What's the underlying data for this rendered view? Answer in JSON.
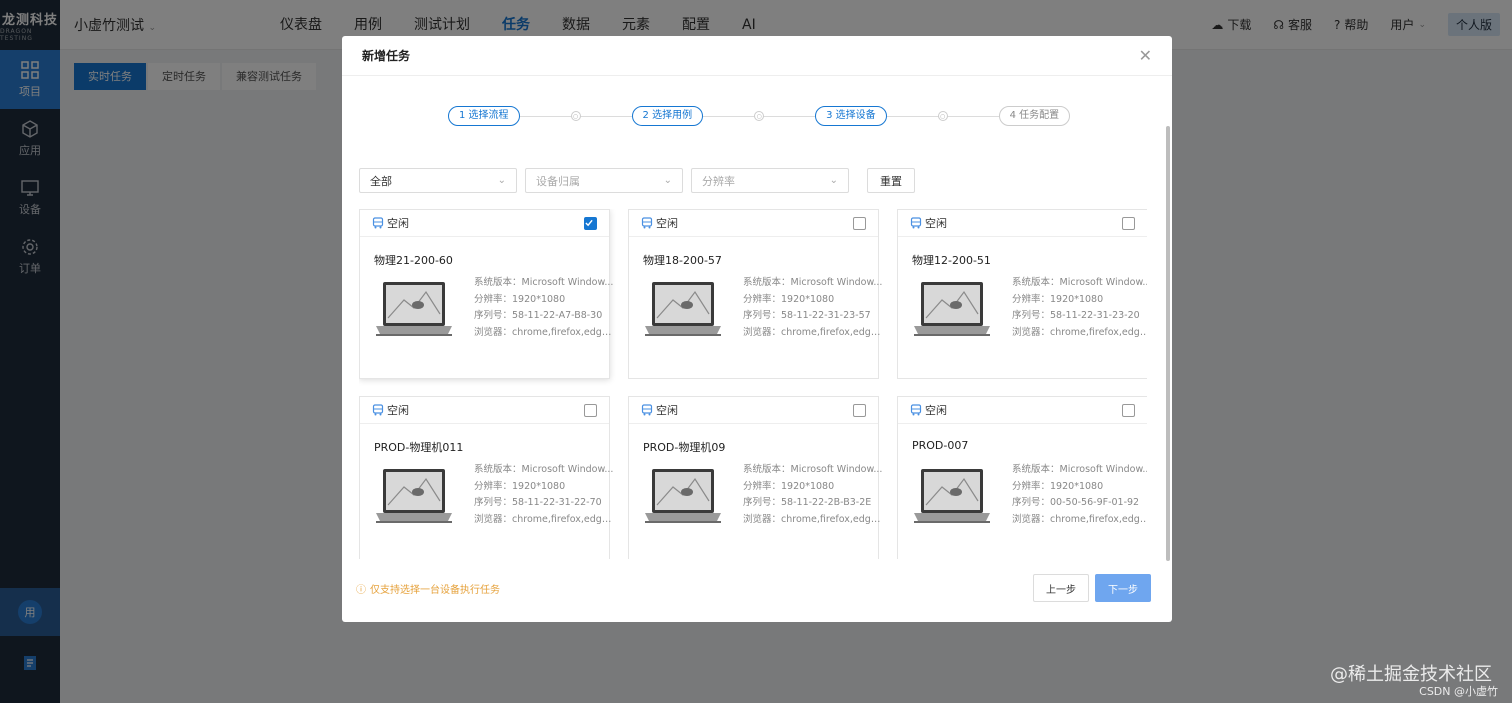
{
  "sidebar": {
    "logo_cn": "龙测科技",
    "logo_en": "DRAGON TESTING",
    "items": [
      {
        "label": "项目",
        "icon": "grid-icon"
      },
      {
        "label": "应用",
        "icon": "cube-icon"
      },
      {
        "label": "设备",
        "icon": "monitor-icon"
      },
      {
        "label": "订单",
        "icon": "gear-icon"
      }
    ],
    "bottom_avatar": "用"
  },
  "topbar": {
    "project": "小虚竹测试",
    "nav": [
      "仪表盘",
      "用例",
      "测试计划",
      "任务",
      "数据",
      "元素",
      "配置",
      "AI"
    ],
    "active_nav": "任务",
    "download": "下载",
    "service": "客服",
    "help": "帮助",
    "user": "用户",
    "edition": "个人版"
  },
  "subtabs": [
    "实时任务",
    "定时任务",
    "兼容测试任务"
  ],
  "modal": {
    "title": "新增任务",
    "steps": [
      "1 选择流程",
      "2 选择用例",
      "3 选择设备",
      "4 任务配置"
    ],
    "filters": {
      "all": "全部",
      "platform_placeholder": "设备归属",
      "resolution_placeholder": "分辨率",
      "reset": "重置"
    },
    "spec_labels": {
      "os": "系统版本：",
      "res": "分辨率：",
      "serial": "序列号：",
      "browser": "浏览器："
    },
    "devices": [
      {
        "status": "空闲",
        "name": "物理21-200-60",
        "os": "Microsoft Window...",
        "res": "1920*1080",
        "serial": "58-11-22-A7-B8-30",
        "browser": "chrome,firefox,edge,ie",
        "checked": true
      },
      {
        "status": "空闲",
        "name": "物理18-200-57",
        "os": "Microsoft Window...",
        "res": "1920*1080",
        "serial": "58-11-22-31-23-57",
        "browser": "chrome,firefox,edge,ie",
        "checked": false
      },
      {
        "status": "空闲",
        "name": "物理12-200-51",
        "os": "Microsoft Window...",
        "res": "1920*1080",
        "serial": "58-11-22-31-23-20",
        "browser": "chrome,firefox,edge,ie",
        "checked": false
      },
      {
        "status": "空闲",
        "name": "PROD-物理机011",
        "os": "Microsoft Window...",
        "res": "1920*1080",
        "serial": "58-11-22-31-22-70",
        "browser": "chrome,firefox,edge,ie",
        "checked": false
      },
      {
        "status": "空闲",
        "name": "PROD-物理机09",
        "os": "Microsoft Window...",
        "res": "1920*1080",
        "serial": "58-11-22-2B-B3-2E",
        "browser": "chrome,firefox,edge,ie",
        "checked": false
      },
      {
        "status": "空闲",
        "name": "PROD-007",
        "os": "Microsoft Window...",
        "res": "1920*1080",
        "serial": "00-50-56-9F-01-92",
        "browser": "chrome,firefox,edge,ie",
        "checked": false
      }
    ],
    "note": "仅支持选择一台设备执行任务",
    "prev": "上一步",
    "next": "下一步"
  },
  "watermark": "@稀土掘金技术社区",
  "watermark_csdn": "CSDN @小虚竹",
  "colors": {
    "accent": "#1677d2",
    "sidebar": "#1f2d3d",
    "warning": "#e6a23c"
  }
}
